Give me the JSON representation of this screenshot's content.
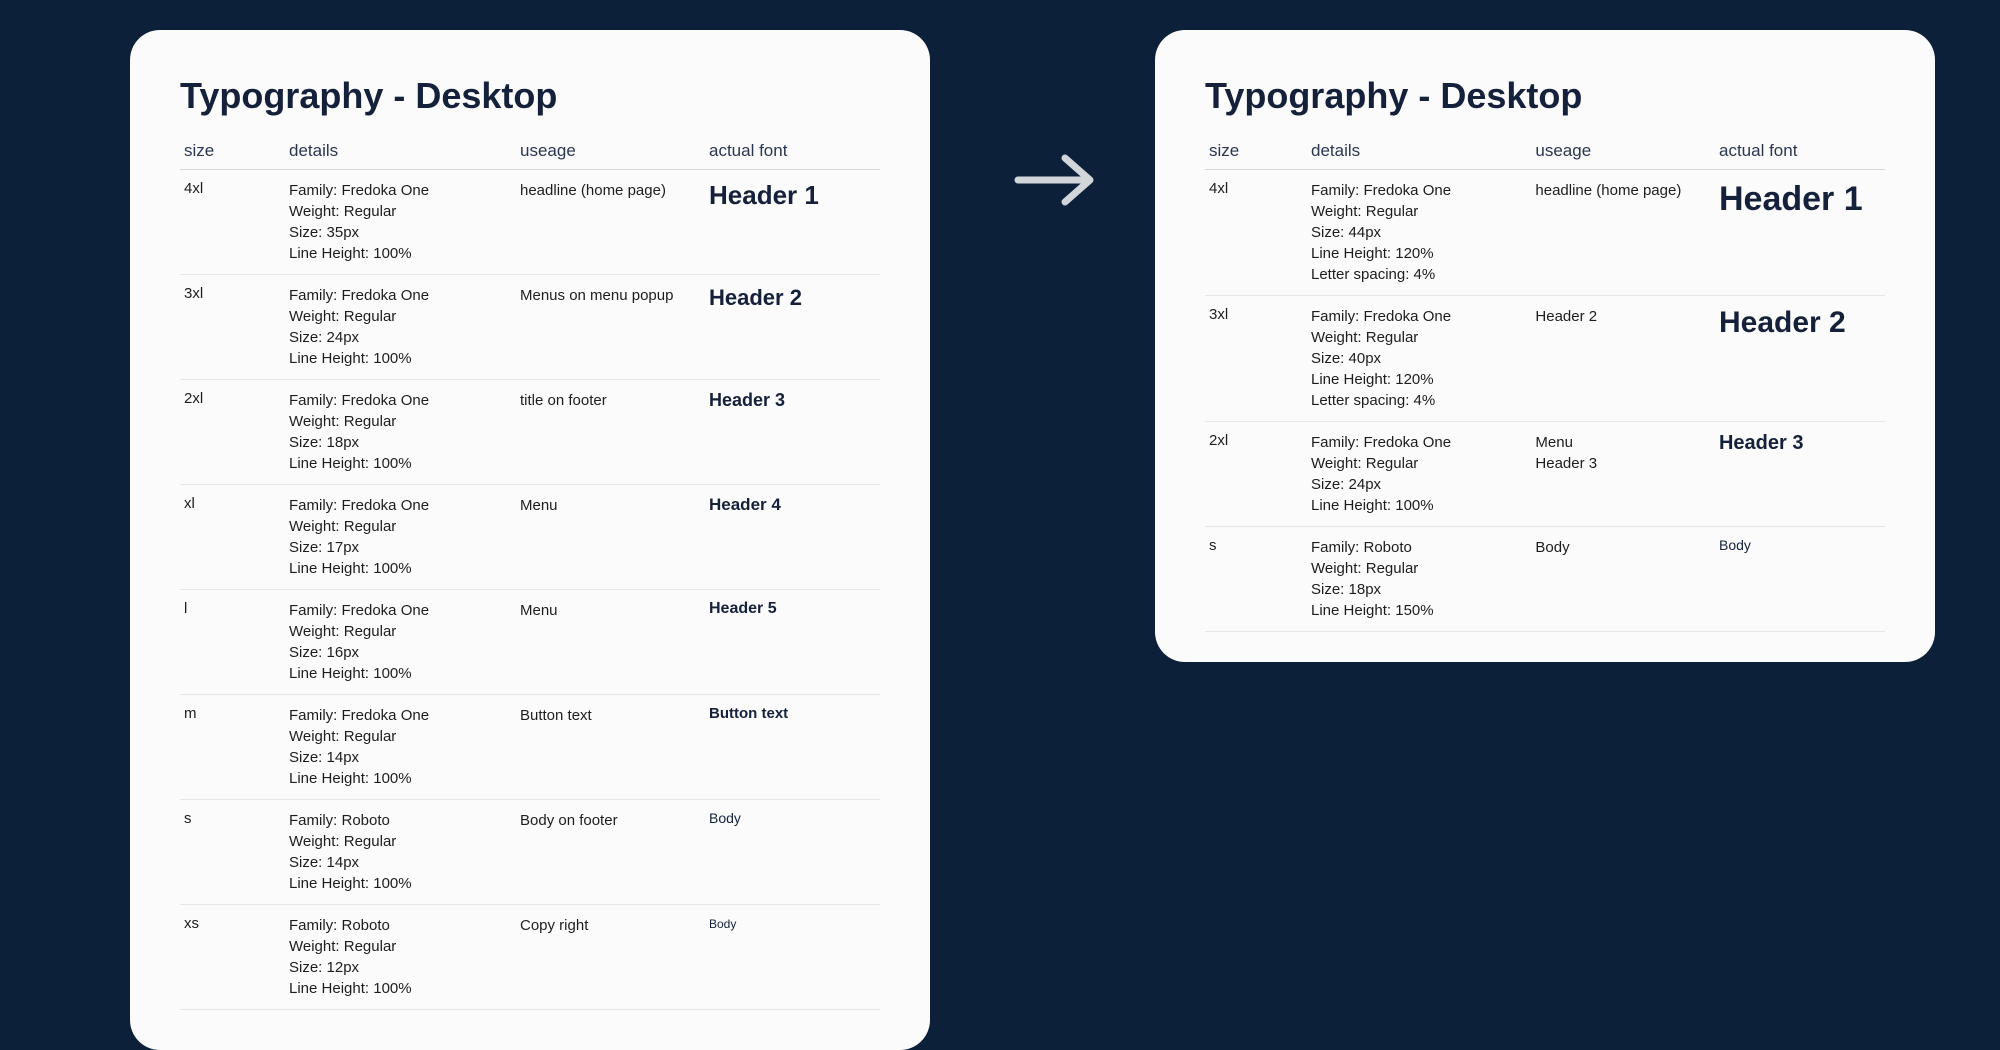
{
  "left": {
    "title": "Typography - Desktop",
    "headers": {
      "size": "size",
      "details": "details",
      "usage": "useage",
      "actual": "actual font"
    },
    "rows": [
      {
        "size": "4xl",
        "details": [
          "Family: Fredoka One",
          "Weight: Regular",
          "Size: 35px",
          "Line Height: 100%"
        ],
        "usage": [
          "headline (home page)"
        ],
        "actual": "Header 1",
        "cls": "h1"
      },
      {
        "size": "3xl",
        "details": [
          "Family: Fredoka One",
          "Weight: Regular",
          "Size: 24px",
          "Line Height: 100%"
        ],
        "usage": [
          "Menus on menu popup"
        ],
        "actual": "Header 2",
        "cls": "h2"
      },
      {
        "size": "2xl",
        "details": [
          "Family: Fredoka One",
          "Weight: Regular",
          "Size: 18px",
          "Line Height: 100%"
        ],
        "usage": [
          "title on footer"
        ],
        "actual": "Header 3",
        "cls": "h3"
      },
      {
        "size": "xl",
        "details": [
          "Family: Fredoka One",
          "Weight: Regular",
          "Size: 17px",
          "Line Height: 100%"
        ],
        "usage": [
          "Menu"
        ],
        "actual": "Header 4",
        "cls": "h4"
      },
      {
        "size": "l",
        "details": [
          "Family: Fredoka One",
          "Weight: Regular",
          "Size: 16px",
          "Line Height: 100%"
        ],
        "usage": [
          "Menu"
        ],
        "actual": "Header 5",
        "cls": "h5"
      },
      {
        "size": "m",
        "details": [
          "Family: Fredoka One",
          "Weight: Regular",
          "Size: 14px",
          "Line Height: 100%"
        ],
        "usage": [
          "Button text"
        ],
        "actual": "Button text",
        "cls": "h6"
      },
      {
        "size": "s",
        "details": [
          "Family: Roboto",
          "Weight: Regular",
          "Size: 14px",
          "Line Height: 100%"
        ],
        "usage": [
          "Body on footer"
        ],
        "actual": "Body",
        "cls": "body"
      },
      {
        "size": "xs",
        "details": [
          "Family: Roboto",
          "Weight: Regular",
          "Size: 12px",
          "Line Height: 100%"
        ],
        "usage": [
          "Copy right"
        ],
        "actual": "Body",
        "cls": "body-sm"
      }
    ]
  },
  "right": {
    "title": "Typography - Desktop",
    "headers": {
      "size": "size",
      "details": "details",
      "usage": "useage",
      "actual": "actual font"
    },
    "rows": [
      {
        "size": "4xl",
        "details": [
          "Family: Fredoka One",
          "Weight: Regular",
          "Size: 44px",
          "Line Height: 120%",
          "Letter spacing: 4%"
        ],
        "usage": [
          "headline (home page)"
        ],
        "actual": "Header 1",
        "cls": "h1"
      },
      {
        "size": "3xl",
        "details": [
          "Family: Fredoka One",
          "Weight: Regular",
          "Size: 40px",
          "Line Height: 120%",
          "Letter spacing: 4%"
        ],
        "usage": [
          "Header 2"
        ],
        "actual": "Header 2",
        "cls": "h2"
      },
      {
        "size": "2xl",
        "details": [
          "Family: Fredoka One",
          "Weight: Regular",
          "Size: 24px",
          "Line Height: 100%"
        ],
        "usage": [
          "Menu",
          "Header 3"
        ],
        "actual": "Header 3",
        "cls": "h3"
      },
      {
        "size": "s",
        "details": [
          "Family: Roboto",
          "Weight: Regular",
          "Size: 18px",
          "Line Height: 150%"
        ],
        "usage": [
          "Body"
        ],
        "actual": "Body",
        "cls": "body"
      }
    ]
  }
}
